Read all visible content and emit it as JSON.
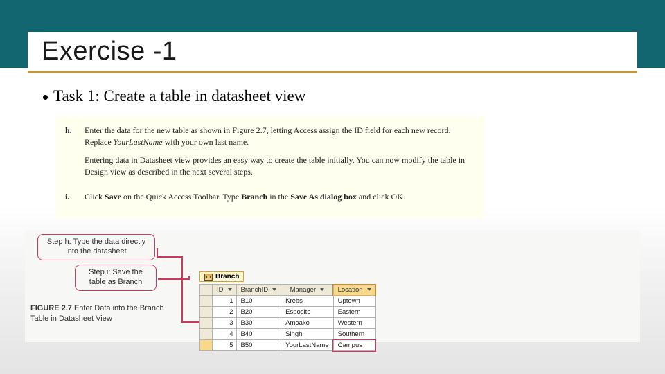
{
  "title": "Exercise -1",
  "bullet": "Task 1: Create a table in datasheet view",
  "instructions": {
    "h": {
      "label": "h.",
      "p1_pre": "Enter the data for the new table as shown in Figure 2.7, letting Access assign the ID field for each new record. Replace ",
      "p1_em": "YourLastName",
      "p1_post": " with your own last name.",
      "p2": "Entering data in Datasheet view provides an easy way to create the table initially. You can now modify the table in Design view as described in the next several steps."
    },
    "i": {
      "label": "i.",
      "p1_a": "Click ",
      "p1_b": "Save",
      "p1_c": " on the Quick Access Toolbar. Type ",
      "p1_d": "Branch",
      "p1_e": " in the ",
      "p1_f": "Save As dialog box",
      "p1_g": " and click OK."
    }
  },
  "callouts": {
    "h": "Step h: Type the data directly into the datasheet",
    "i": "Step i: Save the table as Branch"
  },
  "figure_caption": {
    "label": "FIGURE 2.7",
    "text": " Enter Data into the Branch Table in Datasheet View"
  },
  "tab_name": "Branch",
  "table": {
    "headers": [
      "ID",
      "BranchID",
      "Manager",
      "Location"
    ],
    "rows": [
      {
        "id": "1",
        "branch": "B10",
        "manager": "Krebs",
        "location": "Uptown"
      },
      {
        "id": "2",
        "branch": "B20",
        "manager": "Esposito",
        "location": "Eastern"
      },
      {
        "id": "3",
        "branch": "B30",
        "manager": "Amoako",
        "location": "Western"
      },
      {
        "id": "4",
        "branch": "B40",
        "manager": "Singh",
        "location": "Southern"
      },
      {
        "id": "5",
        "branch": "B50",
        "manager": "YourLastName",
        "location": "Campus"
      }
    ]
  }
}
